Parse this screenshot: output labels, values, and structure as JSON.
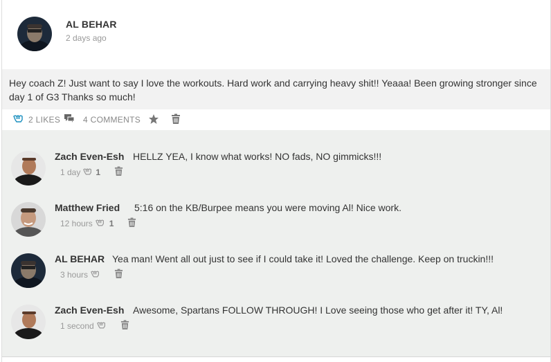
{
  "post": {
    "author": "AL BEHAR",
    "time": "2 days ago",
    "text": "Hey coach Z! Just want to say I love the workouts. Hard work and carrying heavy shit!! Yeaaa!  Been growing stronger since day 1 of G3 Thanks so much!",
    "likes_label": "2 LIKES",
    "comments_label": "4 COMMENTS"
  },
  "comments": [
    {
      "name": "Zach Even-Esh",
      "text": "HELLZ YEA, I know what works! NO fads, NO gimmicks!!!",
      "time": "1 day",
      "likes": "1"
    },
    {
      "name": "Matthew Fried",
      "text": "5:16 on the KB/Burpee means you were moving Al! Nice work.",
      "time": "12 hours",
      "likes": "1"
    },
    {
      "name": "AL BEHAR",
      "text": "Yea man! Went all out just to see if I could take it! Loved the challenge. Keep on truckin!!!",
      "time": "3 hours",
      "likes": ""
    },
    {
      "name": "Zach Even-Esh",
      "text": "Awesome, Spartans FOLLOW THROUGH! I Love seeing those who get after it! TY, Al!",
      "time": "1 second",
      "likes": ""
    }
  ],
  "icons": {
    "like": "like-icon",
    "comment": "comment-icon",
    "star": "star-icon",
    "trash": "trash-icon"
  },
  "colors": {
    "accent": "#1a8fbf",
    "muted": "#999999",
    "comment_bg": "#eef0ee",
    "post_bg": "#f2f2f2"
  }
}
